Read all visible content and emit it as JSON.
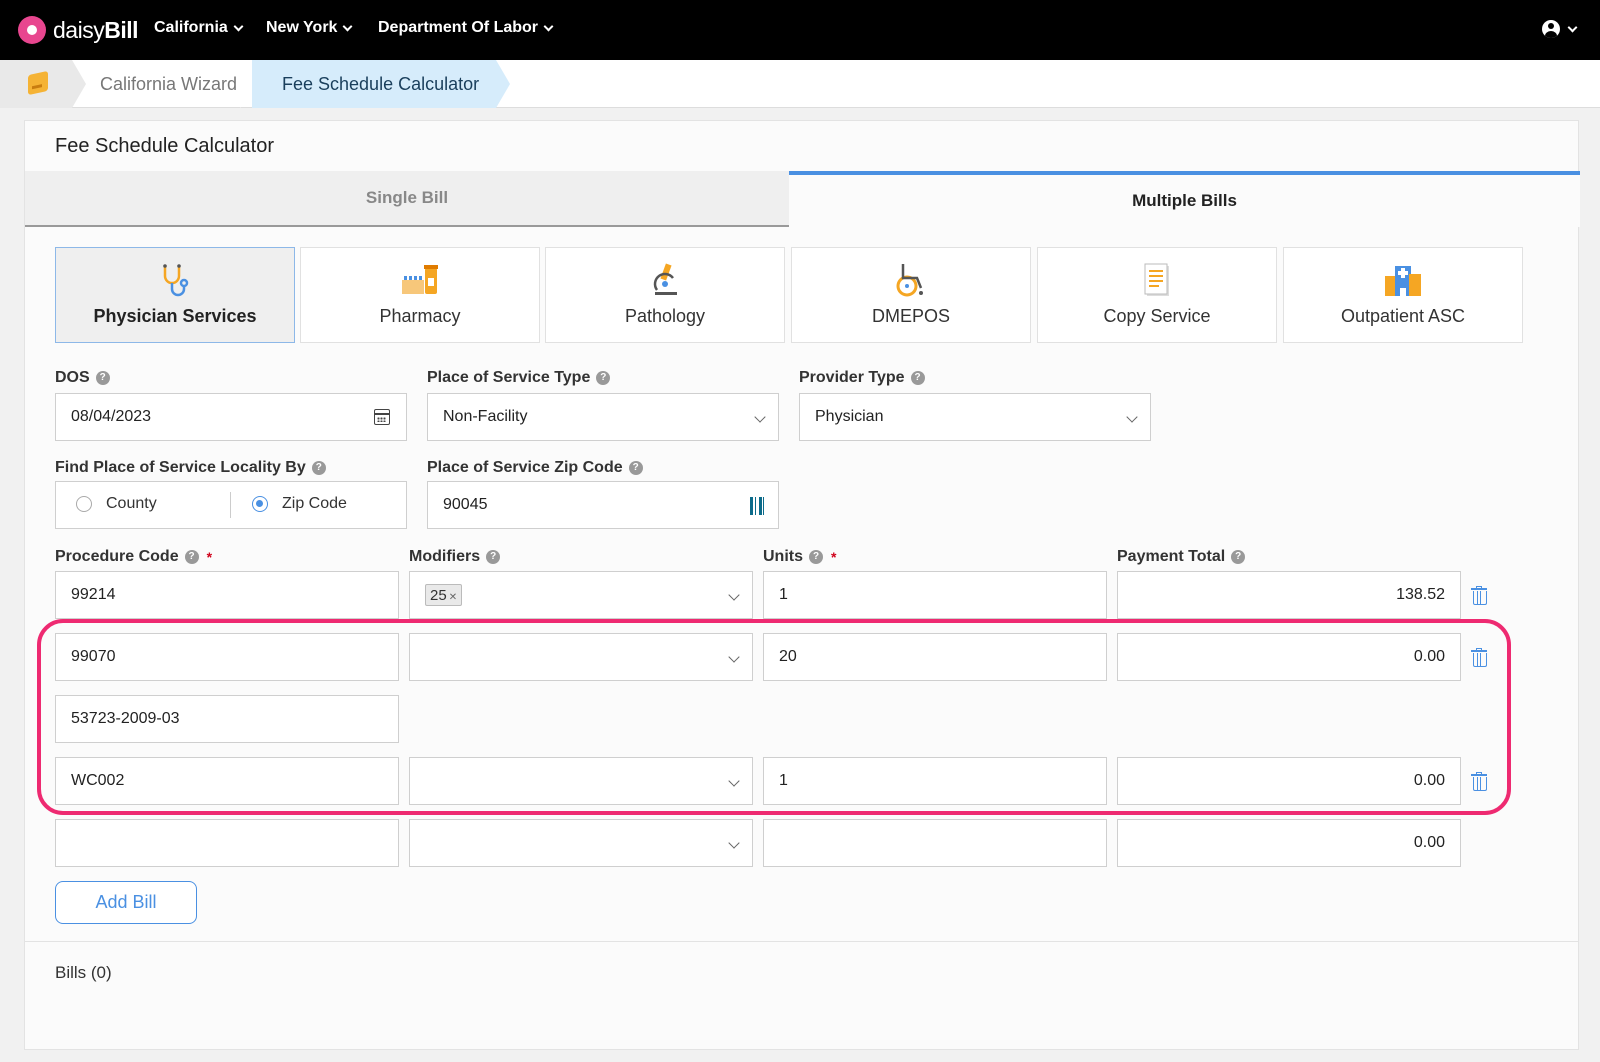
{
  "nav": {
    "logo_text_light": "daisy",
    "logo_text_bold": "Bill",
    "items": [
      "California",
      "New York",
      "Department Of Labor"
    ]
  },
  "breadcrumb": {
    "items": [
      "California Wizard",
      "Fee Schedule Calculator"
    ]
  },
  "page": {
    "title": "Fee Schedule Calculator",
    "tabs": [
      {
        "label": "Single Bill",
        "active": false
      },
      {
        "label": "Multiple Bills",
        "active": true
      }
    ],
    "services": [
      {
        "label": "Physician Services",
        "icon": "stethoscope-icon",
        "selected": true
      },
      {
        "label": "Pharmacy",
        "icon": "pharmacy-icon",
        "selected": false
      },
      {
        "label": "Pathology",
        "icon": "microscope-icon",
        "selected": false
      },
      {
        "label": "DMEPOS",
        "icon": "wheelchair-icon",
        "selected": false
      },
      {
        "label": "Copy Service",
        "icon": "document-icon",
        "selected": false
      },
      {
        "label": "Outpatient ASC",
        "icon": "hospital-icon",
        "selected": false
      }
    ]
  },
  "form": {
    "dos": {
      "label": "DOS",
      "value": "08/04/2023"
    },
    "place_of_service_type": {
      "label": "Place of Service Type",
      "value": "Non-Facility"
    },
    "provider_type": {
      "label": "Provider Type",
      "value": "Physician"
    },
    "find_locality": {
      "label": "Find Place of Service Locality By",
      "options": [
        "County",
        "Zip Code"
      ],
      "selected": "Zip Code"
    },
    "zip_code": {
      "label": "Place of Service Zip Code",
      "value": "90045"
    }
  },
  "table": {
    "headers": {
      "procedure_code": "Procedure Code",
      "modifiers": "Modifiers",
      "units": "Units",
      "payment_total": "Payment Total"
    },
    "rows": [
      {
        "procedure_code": "99214",
        "modifier": "25",
        "units": "1",
        "payment_total": "138.52"
      },
      {
        "procedure_code": "99070",
        "modifier": "",
        "units": "20",
        "payment_total": "0.00"
      },
      {
        "ndc": "53723-2009-03"
      },
      {
        "procedure_code": "WC002",
        "modifier": "",
        "units": "1",
        "payment_total": "0.00"
      },
      {
        "procedure_code": "",
        "modifier": "",
        "units": "",
        "payment_total": "0.00"
      }
    ]
  },
  "actions": {
    "add_bill": "Add Bill"
  },
  "bills": {
    "label": "Bills (0)"
  },
  "colors": {
    "accent": "#4a90e2",
    "highlight": "#ee2a71",
    "brand": "#e8468f"
  }
}
